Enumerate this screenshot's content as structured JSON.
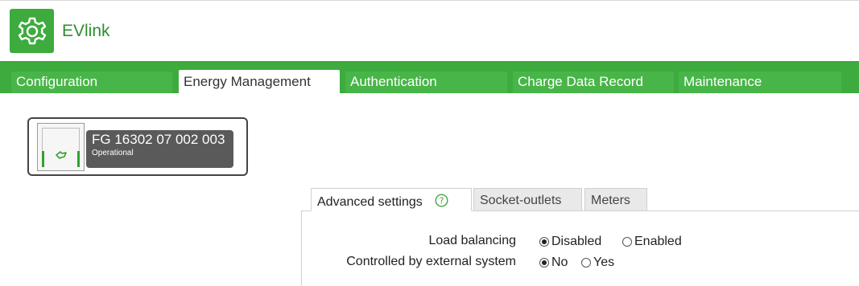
{
  "app": {
    "name": "EVlink",
    "logo_icon": "gear-icon"
  },
  "main_tabs": [
    {
      "label": "Configuration",
      "active": false
    },
    {
      "label": "Energy Management",
      "active": true
    },
    {
      "label": "Authentication",
      "active": false
    },
    {
      "label": "Charge Data Record",
      "active": false
    },
    {
      "label": "Maintenance",
      "active": false
    }
  ],
  "device": {
    "id": "FG 16302 07 002 003",
    "status": "Operational"
  },
  "sub_tabs": [
    {
      "label": "Advanced settings",
      "active": true,
      "help_icon": "help-icon"
    },
    {
      "label": "Socket-outlets",
      "active": false
    },
    {
      "label": "Meters",
      "active": false
    }
  ],
  "settings": {
    "load_balancing": {
      "label": "Load balancing",
      "options": [
        {
          "label": "Disabled",
          "selected": true
        },
        {
          "label": "Enabled",
          "selected": false
        }
      ]
    },
    "external_system": {
      "label": "Controlled by external system",
      "options": [
        {
          "label": "No",
          "selected": true
        },
        {
          "label": "Yes",
          "selected": false
        }
      ]
    }
  },
  "colors": {
    "brand_green": "#3dab3d",
    "tab_green": "#48b548",
    "device_box": "#5a5a5a"
  }
}
